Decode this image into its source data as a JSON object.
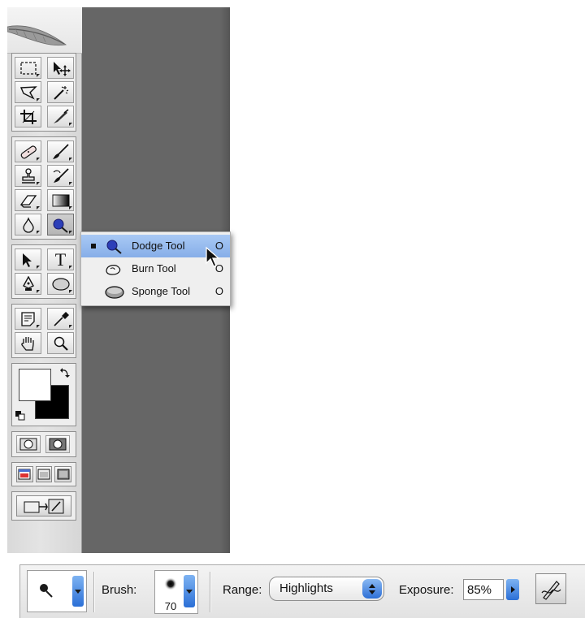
{
  "flyout_menu": {
    "items": [
      {
        "label": "Dodge Tool",
        "shortcut": "O",
        "icon": "dodge-icon",
        "selected": true
      },
      {
        "label": "Burn Tool",
        "shortcut": "O",
        "icon": "burn-icon",
        "selected": false
      },
      {
        "label": "Sponge Tool",
        "shortcut": "O",
        "icon": "sponge-icon",
        "selected": false
      }
    ]
  },
  "palette": {
    "logo": "feather-logo",
    "tools": [
      "rectangular-marquee-icon",
      "move-icon",
      "lasso-icon",
      "magic-wand-icon",
      "crop-icon",
      "slice-icon",
      "healing-brush-icon",
      "brush-icon",
      "clone-stamp-icon",
      "history-brush-icon",
      "eraser-icon",
      "gradient-icon",
      "blur-icon",
      "dodge-icon",
      "path-selection-icon",
      "type-icon",
      "pen-icon",
      "ellipse-shape-icon",
      "notes-icon",
      "eyedropper-icon",
      "hand-icon",
      "zoom-icon"
    ],
    "type_tool_glyph": "T",
    "foreground_color": "#ffffff",
    "background_color": "#000000"
  },
  "options_bar": {
    "brush_label": "Brush:",
    "brush_size": "70",
    "range_label": "Range:",
    "range_value": "Highlights",
    "exposure_label": "Exposure:",
    "exposure_value": "85%"
  },
  "colors": {
    "canvas_gray": "#666666",
    "menu_highlight": "#96bbee",
    "accent_blue": "#2b6fd6"
  }
}
